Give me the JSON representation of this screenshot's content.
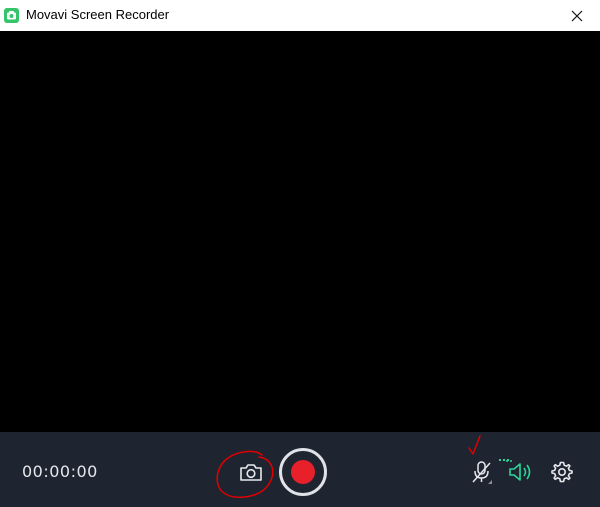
{
  "window": {
    "title": "Movavi Screen Recorder",
    "app_icon": "movavi-recorder-icon",
    "close_icon": "close-icon"
  },
  "preview": {
    "background": "#000000"
  },
  "controls": {
    "timer": "00:00:00",
    "bar_background": "#1e2430",
    "buttons": [
      {
        "name": "camera-screenshot-button",
        "icon": "camera-icon"
      },
      {
        "name": "record-button",
        "icon": "record-icon",
        "color": "#e8202a"
      },
      {
        "name": "microphone-button",
        "icon": "microphone-muted-icon",
        "state": "muted"
      },
      {
        "name": "system-audio-button",
        "icon": "speaker-icon",
        "state": "enabled",
        "color": "#2bd59a"
      },
      {
        "name": "settings-button",
        "icon": "gear-icon"
      }
    ]
  },
  "annotations": {
    "color": "#e00000",
    "marks": [
      "circle-around-camera",
      "checkmark-above-microphone"
    ]
  }
}
